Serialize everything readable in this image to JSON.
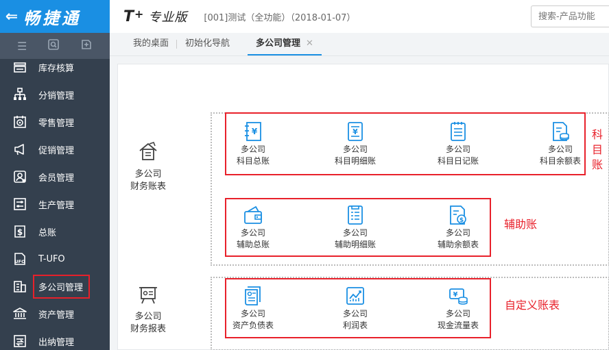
{
  "brand": {
    "back": "⇐",
    "title": "畅捷通"
  },
  "header": {
    "logo": "T",
    "logo_plus": "+",
    "edition": "专业版",
    "account": "[001]测试（全功能）（2018-01-07）",
    "search_placeholder": "搜索-产品功能"
  },
  "sidebar": {
    "tools": [
      "menu-icon",
      "search-icon",
      "add-icon"
    ],
    "items": [
      {
        "label": "库存核算",
        "icon": "inventory-icon"
      },
      {
        "label": "分销管理",
        "icon": "distribution-icon"
      },
      {
        "label": "零售管理",
        "icon": "retail-icon"
      },
      {
        "label": "促销管理",
        "icon": "promotion-icon"
      },
      {
        "label": "会员管理",
        "icon": "member-icon"
      },
      {
        "label": "生产管理",
        "icon": "production-icon"
      },
      {
        "label": "总账",
        "icon": "ledger-icon"
      },
      {
        "label": "T-UFO",
        "icon": "ufo-icon"
      },
      {
        "label": "多公司管理",
        "icon": "multi-company-icon"
      },
      {
        "label": "资产管理",
        "icon": "asset-icon"
      },
      {
        "label": "出纳管理",
        "icon": "cashier-icon"
      }
    ]
  },
  "tabs": [
    {
      "label": "我的桌面"
    },
    {
      "label": "初始化导航"
    },
    {
      "label": "多公司管理",
      "close": "✕"
    }
  ],
  "categories": {
    "finance": {
      "line1": "多公司",
      "line2": "财务账表"
    },
    "report": {
      "line1": "多公司",
      "line2": "财务报表"
    }
  },
  "groups": {
    "subject": [
      {
        "line1": "多公司",
        "line2": "科目总账",
        "icon": "ledger-book-icon"
      },
      {
        "line1": "多公司",
        "line2": "科目明细账",
        "icon": "detail-ledger-icon"
      },
      {
        "line1": "多公司",
        "line2": "科目日记账",
        "icon": "journal-icon"
      },
      {
        "line1": "多公司",
        "line2": "科目余额表",
        "icon": "balance-sheet-icon"
      }
    ],
    "auxiliary": [
      {
        "line1": "多公司",
        "line2": "辅助总账",
        "icon": "wallet-icon"
      },
      {
        "line1": "多公司",
        "line2": "辅助明细账",
        "icon": "aux-detail-icon"
      },
      {
        "line1": "多公司",
        "line2": "辅助余额表",
        "icon": "aux-balance-icon"
      }
    ],
    "reports": [
      {
        "line1": "多公司",
        "line2": "资产负债表",
        "icon": "balance-report-icon"
      },
      {
        "line1": "多公司",
        "line2": "利润表",
        "icon": "profit-chart-icon"
      },
      {
        "line1": "多公司",
        "line2": "现金流量表",
        "icon": "cashflow-icon"
      }
    ]
  },
  "annotations": {
    "subject": [
      "科",
      "目",
      "账"
    ],
    "auxiliary": "辅助账",
    "custom": "自定义账表"
  },
  "colors": {
    "brand": "#1a8fe3",
    "sidebar": "#34404e",
    "icon": "#1a8fe3",
    "annotation": "#e8202a"
  }
}
